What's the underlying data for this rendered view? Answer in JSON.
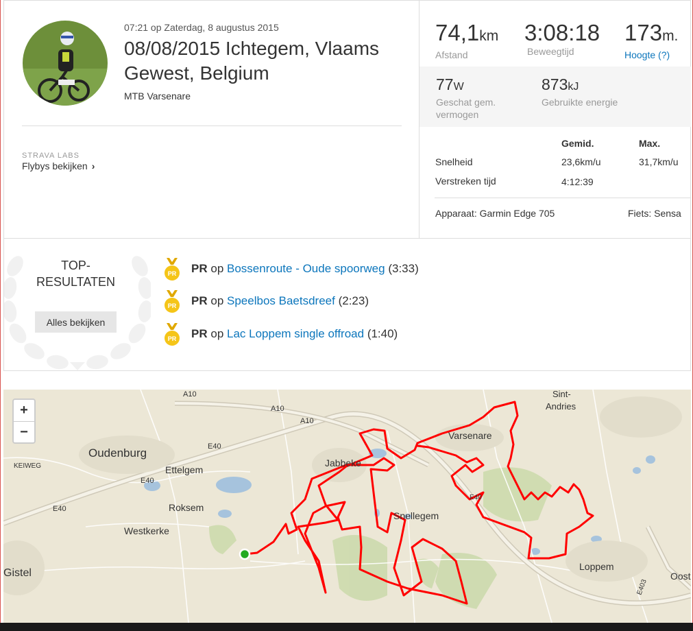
{
  "activity": {
    "datetime": "07:21 op Zaterdag, 8 augustus 2015",
    "title": "08/08/2015 Ichtegem, Vlaams Gewest, Belgium",
    "subtitle": "MTB Varsenare",
    "labs_title": "STRAVA LABS",
    "flyby_link": "Flybys bekijken",
    "flyby_chevron": "›"
  },
  "stats": {
    "distance": {
      "value": "74,1",
      "unit": "km",
      "label": "Afstand"
    },
    "moving_time": {
      "value": "3:08:18",
      "label": "Beweegtijd"
    },
    "elevation": {
      "value": "173",
      "unit": "m.",
      "label": "Hoogte (?)"
    },
    "power": {
      "value": "77",
      "unit": "W",
      "label": "Geschat gem. vermogen"
    },
    "energy": {
      "value": "873",
      "unit": "kJ",
      "label": "Gebruikte energie"
    }
  },
  "detail_table": {
    "col_avg": "Gemid.",
    "col_max": "Max.",
    "rows": [
      {
        "label": "Snelheid",
        "avg": "23,6km/u",
        "max": "31,7km/u"
      },
      {
        "label": "Verstreken tijd",
        "avg": "4:12:39",
        "max": ""
      }
    ],
    "device": "Apparaat: Garmin Edge 705",
    "bike": "Fiets: Sensa"
  },
  "achievements": {
    "heading_line1": "TOP-",
    "heading_line2": "RESULTATEN",
    "see_all": "Alles bekijken",
    "medal_text": "PR",
    "items": [
      {
        "prefix": "PR",
        "op": "op",
        "segment": "Bossenroute - Oude spoorweg",
        "time": "(3:33)"
      },
      {
        "prefix": "PR",
        "op": "op",
        "segment": "Speelbos Baetsdreef",
        "time": "(2:23)"
      },
      {
        "prefix": "PR",
        "op": "op",
        "segment": "Lac Loppem single offroad",
        "time": "(1:40)"
      }
    ]
  },
  "map": {
    "zoom_in": "+",
    "zoom_out": "−",
    "labels": {
      "a10_1": "A10",
      "a10_2": "A10",
      "a10_3": "A10",
      "e40_1": "E40",
      "e40_2": "E40",
      "e40_3": "E40",
      "e40_4": "E40",
      "e403": "E403",
      "keiweg": "KEIWEG",
      "oudenburg": "Oudenburg",
      "ettelgem": "Ettelgem",
      "roksem": "Roksem",
      "westkerke": "Westkerke",
      "gistel": "Gistel",
      "jabbeke": "Jabbeke",
      "snellegem": "Snellegem",
      "varsenare": "Varsenare",
      "sint_andries_1": "Sint-",
      "sint_andries_2": "Andries",
      "loppem": "Loppem",
      "oost": "Oost"
    },
    "route_color": "#ff0000",
    "start_marker_color": "#22aa22"
  }
}
